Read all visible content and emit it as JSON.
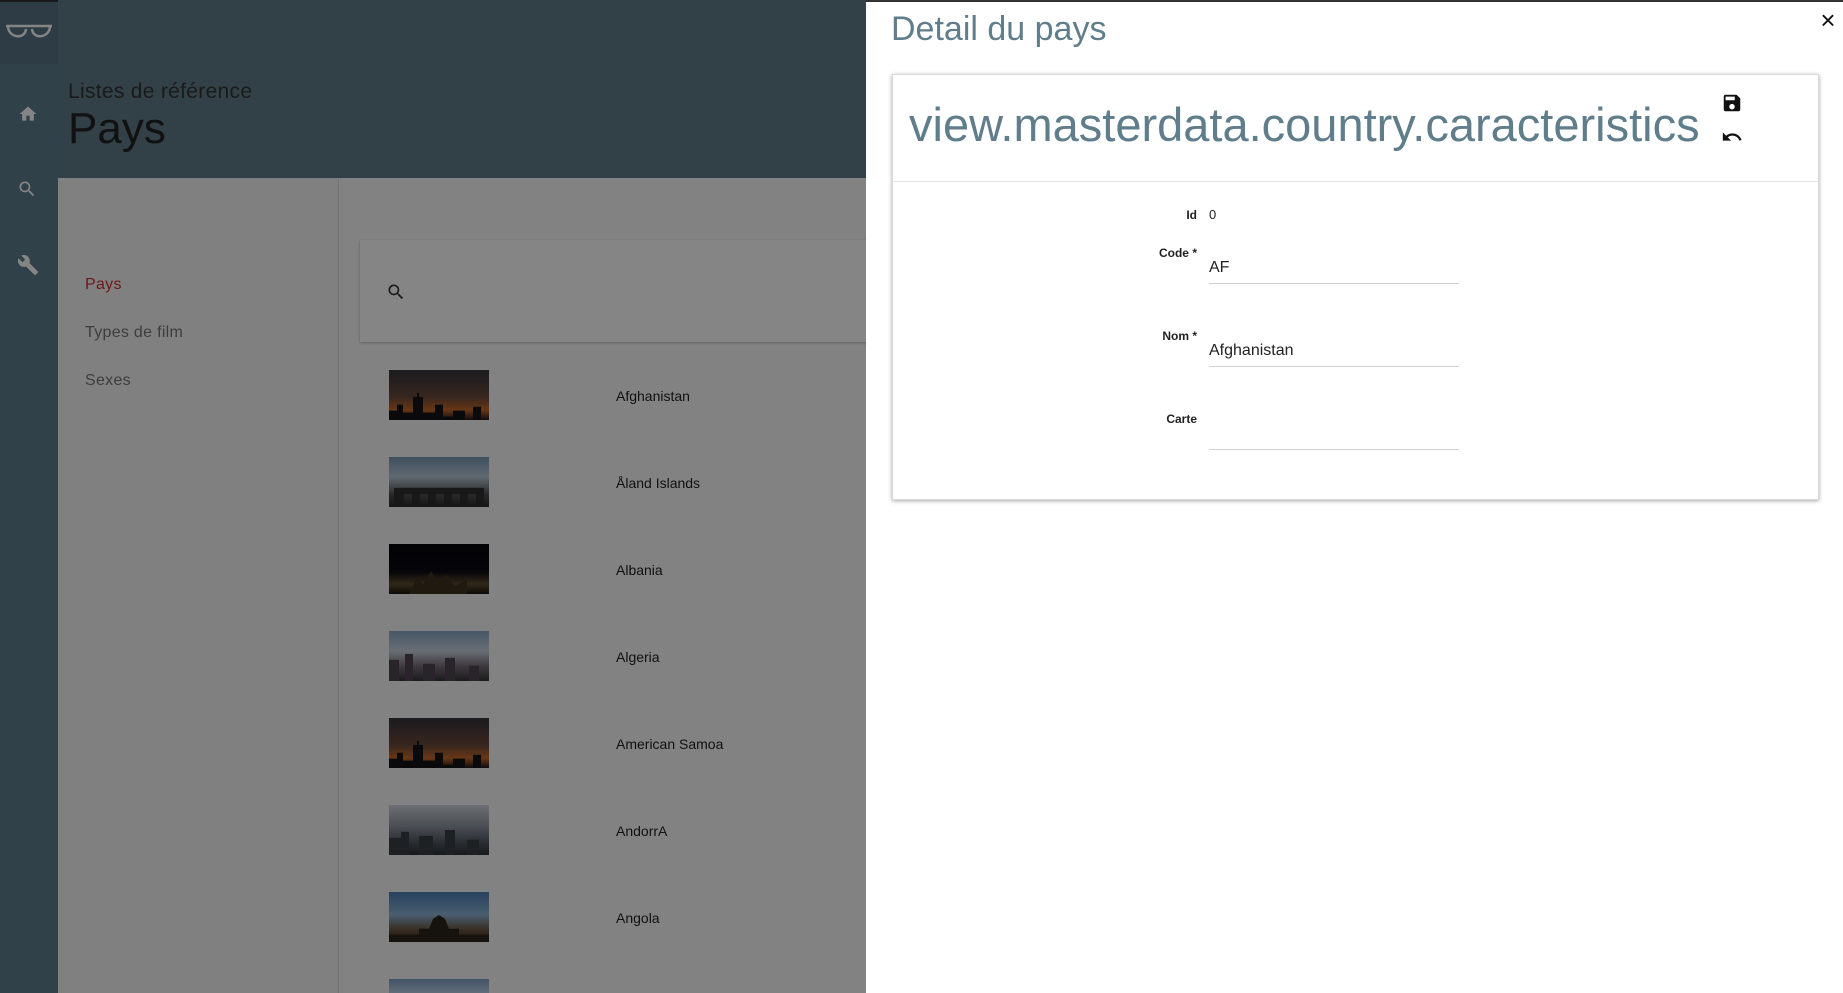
{
  "rail": {
    "logo_icon": "glasses-icon",
    "items": [
      {
        "icon": "home-icon"
      },
      {
        "icon": "search-icon"
      },
      {
        "icon": "wrench-icon"
      }
    ]
  },
  "header": {
    "subtitle": "Listes de référence",
    "title": "Pays"
  },
  "sidenav": {
    "items": [
      {
        "label": "Pays",
        "active": true
      },
      {
        "label": "Types de film",
        "active": false
      },
      {
        "label": "Sexes",
        "active": false
      }
    ]
  },
  "search": {
    "icon": "search-icon"
  },
  "countries": [
    {
      "name": "Afghanistan"
    },
    {
      "name": "Åland Islands"
    },
    {
      "name": "Albania"
    },
    {
      "name": "Algeria"
    },
    {
      "name": "American Samoa"
    },
    {
      "name": "AndorrA"
    },
    {
      "name": "Angola"
    },
    {
      "name": ""
    }
  ],
  "panel": {
    "title": "Detail du pays",
    "close_label": "×",
    "card_title": "view.masterdata.country.caracteristics",
    "actions": {
      "save_icon": "save-icon",
      "undo_icon": "undo-icon"
    },
    "fields": {
      "id": {
        "label": "Id",
        "value": "0"
      },
      "code": {
        "label": "Code *",
        "value": "AF"
      },
      "nom": {
        "label": "Nom *",
        "value": "Afghanistan"
      },
      "carte": {
        "label": "Carte",
        "value": ""
      }
    }
  },
  "colors": {
    "rail": "#5f7e8f",
    "accent": "#607d8b",
    "active_nav": "#d32f2f"
  }
}
